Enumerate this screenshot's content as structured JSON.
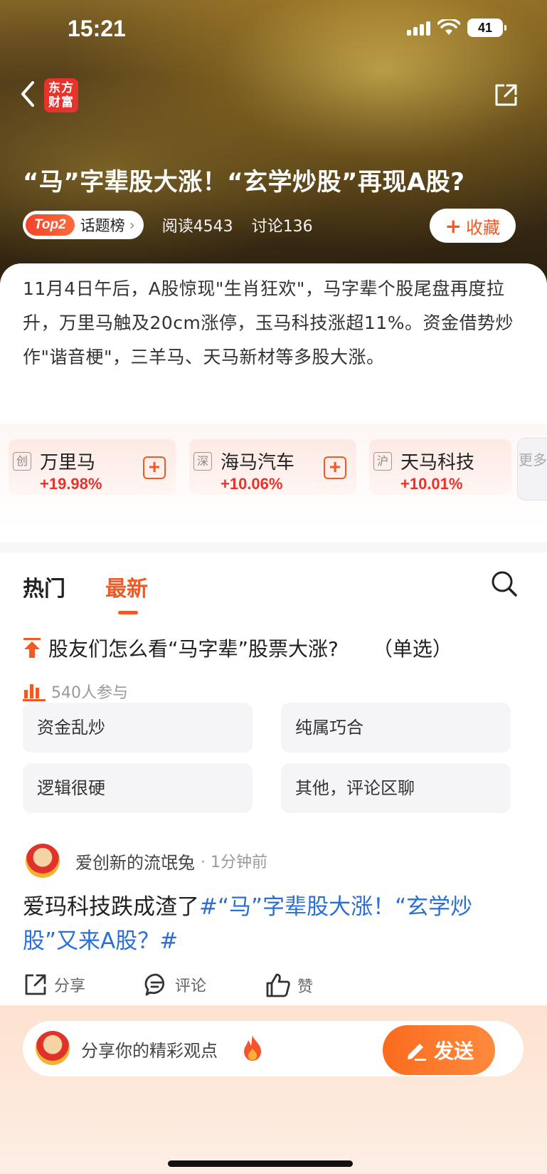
{
  "status_bar": {
    "time": "15:21",
    "battery": "41"
  },
  "header": {
    "logo_line1": "东方",
    "logo_line2": "财富",
    "title": "“马”字辈股大涨！“玄学炒股”再现A股?",
    "topic_rank": "Top2",
    "topic_label": "话题榜",
    "reads": "阅读4543",
    "discussions": "讨论136",
    "collect_label": "收藏"
  },
  "description": "11月4日午后，A股惊现\"生肖狂欢\"，马字辈个股尾盘再度拉升，万里马触及20cm涨停，玉马科技涨超11%。资金借势炒作\"谐音梗\"，三羊马、天马新材等多股大涨。",
  "stocks": [
    {
      "exchange": "创",
      "name": "万里马",
      "change": "+19.98%"
    },
    {
      "exchange": "深",
      "name": "海马汽车",
      "change": "+10.06%"
    },
    {
      "exchange": "沪",
      "name": "天马科技",
      "change": "+10.01%"
    }
  ],
  "more_label": "更多",
  "tabs": {
    "hot": "热门",
    "latest": "最新"
  },
  "poll": {
    "question": "股友们怎么看“马字辈”股票大涨?",
    "mode": "（单选）",
    "participants": "540人参与",
    "options": [
      "资金乱炒",
      "纯属巧合",
      "逻辑很硬",
      "其他，评论区聊"
    ]
  },
  "post": {
    "username": "爱创新的流氓兔",
    "time": "· 1分钟前",
    "text": "爱玛科技跌成渣了",
    "tag": "#“马”字辈股大涨！“玄学炒股”又来A股？#",
    "share_label": "分享",
    "comment_label": "评论",
    "like_label": "赞"
  },
  "composer": {
    "placeholder": "分享你的精彩观点",
    "send_label": "发送"
  },
  "colors": {
    "accent": "#f15a24",
    "rise": "#e8322c",
    "link": "#2a6fd6"
  }
}
